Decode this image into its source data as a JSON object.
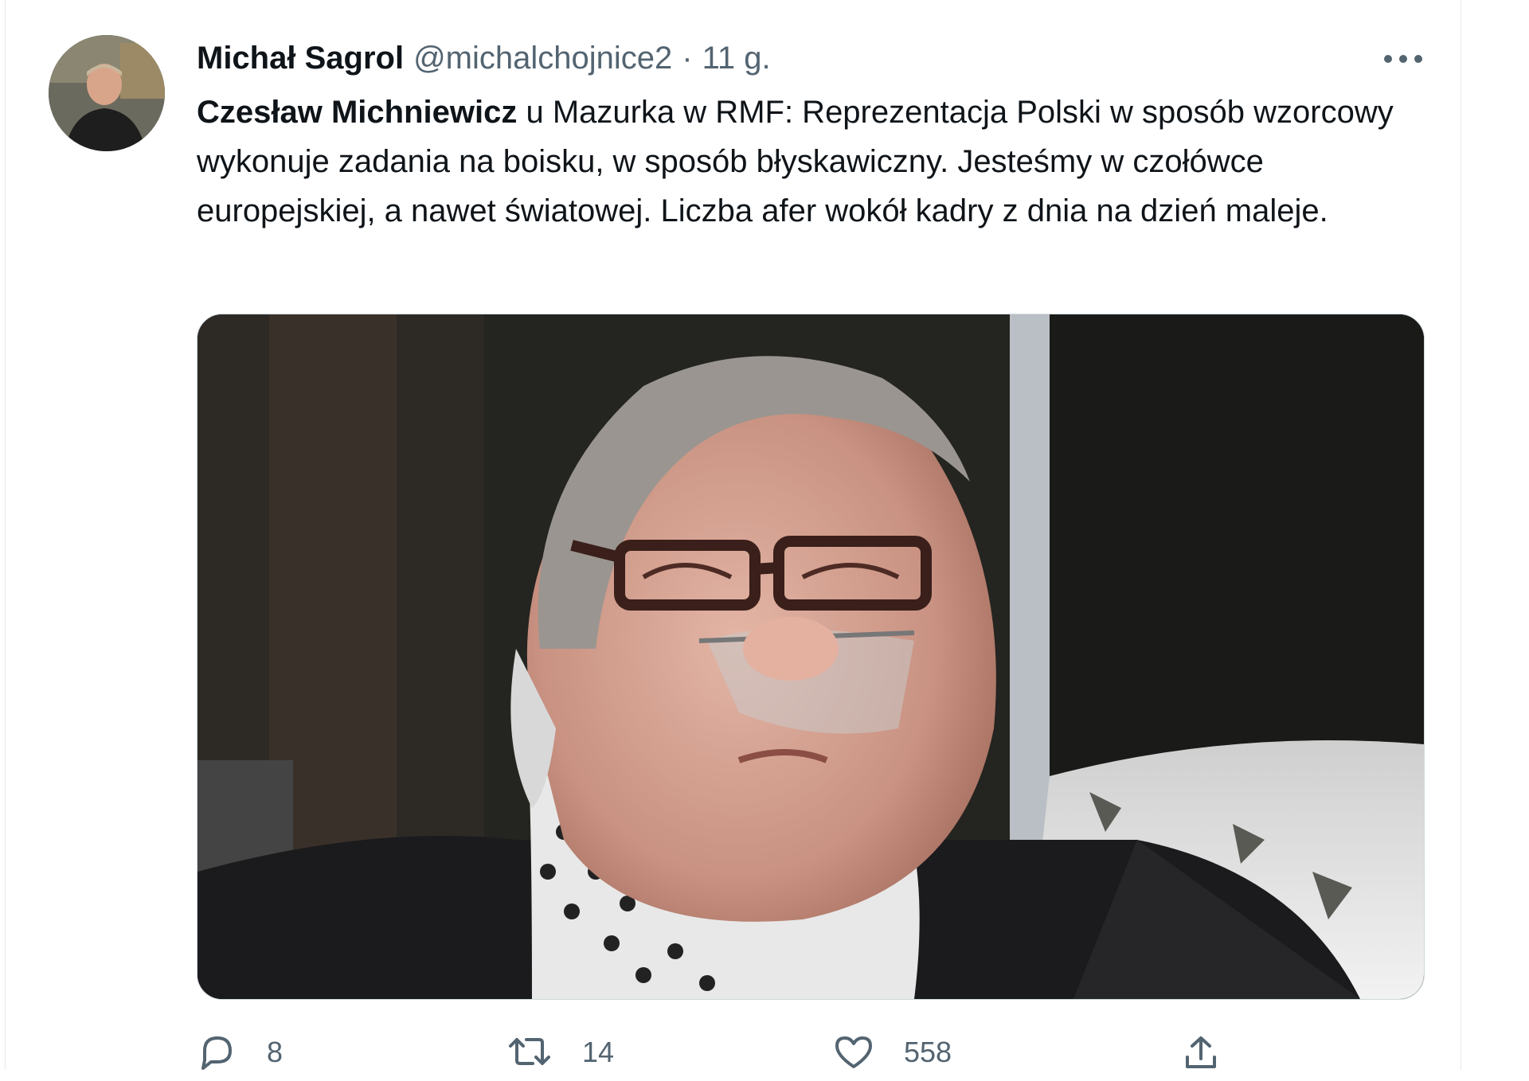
{
  "tweet": {
    "author_name": "Michał Sagrol",
    "author_handle": "@michalchojnice2",
    "separator": "·",
    "time": "11 g.",
    "text_mention": "Czesław Michniewicz",
    "text_body": " u Mazurka w RMF: Reprezentacja Polski  w sposób wzorcowy wykonuje zadania na boisku, w sposób błyskawiczny. Jesteśmy w czołówce europejskiej, a nawet światowej. Liczba afer wokół kadry z dnia na dzień maleje."
  },
  "actions": {
    "reply_count": "8",
    "retweet_count": "14",
    "like_count": "558"
  },
  "icons": {
    "more": "more-horizontal-icon",
    "reply": "reply-icon",
    "retweet": "retweet-icon",
    "like": "heart-icon",
    "share": "share-icon"
  },
  "colors": {
    "text_primary": "#0f1419",
    "text_secondary": "#536471",
    "border": "#cfd9de"
  }
}
